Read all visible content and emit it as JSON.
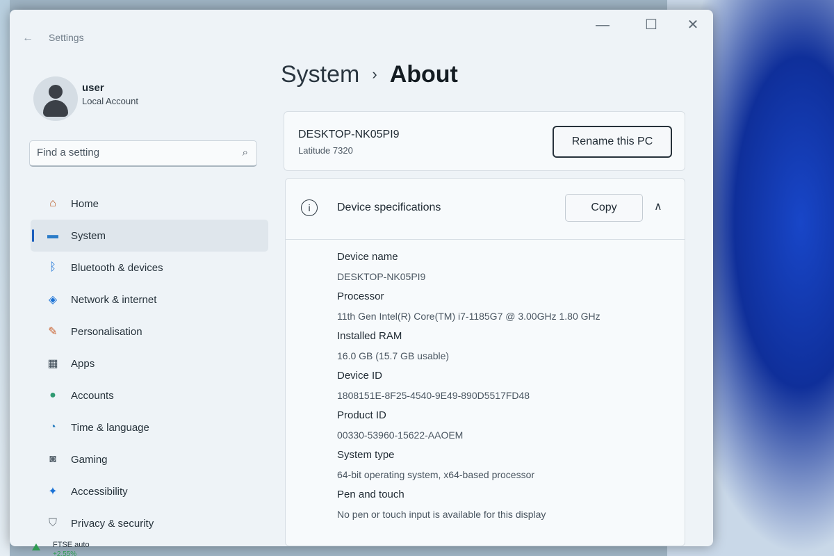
{
  "window": {
    "title": "Settings",
    "back_glyph": "←",
    "minimize_glyph": "—",
    "maximize_glyph": "☐",
    "close_glyph": "✕"
  },
  "user": {
    "name": "user",
    "account_type": "Local Account"
  },
  "search": {
    "placeholder": "Find a setting",
    "icon": "search-icon",
    "icon_glyph": "⌕"
  },
  "sidebar": {
    "items": [
      {
        "label": "Home",
        "icon": "home-icon",
        "glyph": "⌂",
        "active": false
      },
      {
        "label": "System",
        "icon": "monitor-icon",
        "glyph": "▬",
        "active": true
      },
      {
        "label": "Bluetooth & devices",
        "icon": "bluetooth-icon",
        "glyph": "ᛒ",
        "active": false
      },
      {
        "label": "Network & internet",
        "icon": "wifi-icon",
        "glyph": "◈",
        "active": false
      },
      {
        "label": "Personalisation",
        "icon": "brush-icon",
        "glyph": "✎",
        "active": false
      },
      {
        "label": "Apps",
        "icon": "apps-icon",
        "glyph": "▦",
        "active": false
      },
      {
        "label": "Accounts",
        "icon": "person-icon",
        "glyph": "●",
        "active": false
      },
      {
        "label": "Time & language",
        "icon": "globe-clock-icon",
        "glyph": "◔",
        "active": false
      },
      {
        "label": "Gaming",
        "icon": "controller-icon",
        "glyph": "◙",
        "active": false
      },
      {
        "label": "Accessibility",
        "icon": "accessibility-icon",
        "glyph": "✦",
        "active": false
      },
      {
        "label": "Privacy & security",
        "icon": "shield-icon",
        "glyph": "⛉",
        "active": false
      }
    ]
  },
  "breadcrumb": {
    "parent": "System",
    "separator": "›",
    "current": "About"
  },
  "pc_card": {
    "name": "DESKTOP-NK05PI9",
    "model": "Latitude 7320",
    "rename_label": "Rename this PC"
  },
  "specs": {
    "title": "Device specifications",
    "info_glyph": "i",
    "copy_label": "Copy",
    "collapse_glyph": "∧",
    "rows": [
      {
        "label": "Device name",
        "value": "DESKTOP-NK05PI9"
      },
      {
        "label": "Processor",
        "value": "11th Gen Intel(R) Core(TM) i7-1185G7 @ 3.00GHz   1.80 GHz"
      },
      {
        "label": "Installed RAM",
        "value": "16.0 GB (15.7 GB usable)"
      },
      {
        "label": "Device ID",
        "value": "1808151E-8F25-4540-9E49-890D5517FD48"
      },
      {
        "label": "Product ID",
        "value": "00330-53960-15622-AAOEM"
      },
      {
        "label": "System type",
        "value": "64-bit operating system, x64-based processor"
      },
      {
        "label": "Pen and touch",
        "value": "No pen or touch input is available for this display"
      }
    ]
  },
  "taskbar": {
    "ticker_label": "FTSE auto",
    "ticker_value": "+2.55%"
  }
}
